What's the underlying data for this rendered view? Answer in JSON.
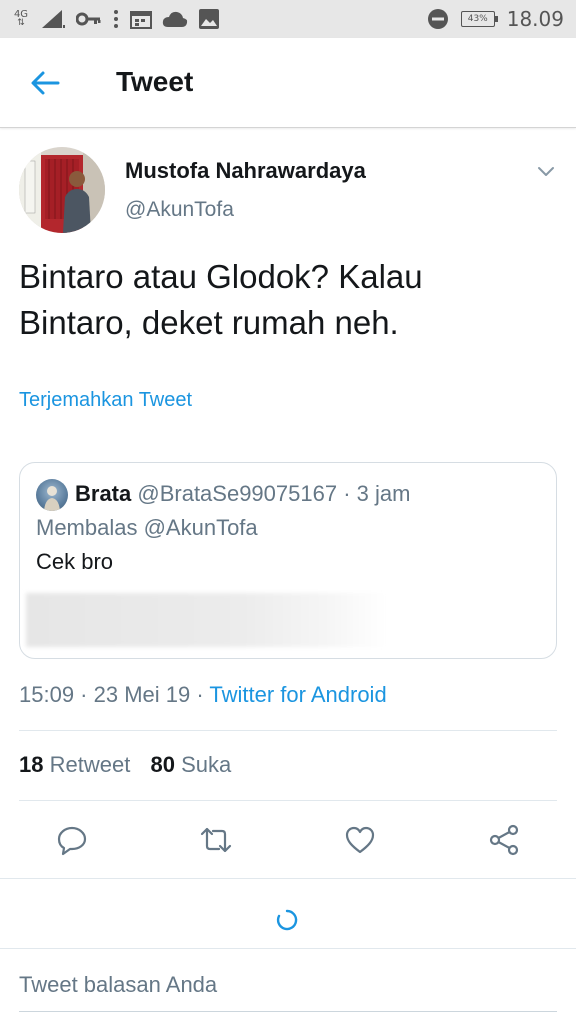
{
  "status_bar": {
    "network": "4G",
    "battery": "43%",
    "time": "18.09"
  },
  "header": {
    "title": "Tweet"
  },
  "tweet": {
    "author_name": "Mustofa Nahrawardaya",
    "author_handle": "@AkunTofa",
    "text_line1": "Bintaro atau Glodok? Kalau",
    "text_line2": "Bintaro, deket rumah neh.",
    "translate_label": "Terjemahkan Tweet",
    "time_date": "15:09 · 23 Mei 19 · ",
    "source": "Twitter for Android"
  },
  "quoted_tweet": {
    "name": "Brata",
    "meta": "@BrataSe99075167 · 3 jam",
    "replying_to": "Membalas @AkunTofa",
    "text": "Cek bro"
  },
  "stats": {
    "retweet_count": "18",
    "retweet_label": "Retweet",
    "like_count": "80",
    "like_label": "Suka"
  },
  "actions": [
    "reply-icon",
    "retweet-icon",
    "like-icon",
    "share-icon"
  ],
  "reply_box": {
    "placeholder": "Tweet balasan Anda"
  },
  "colors": {
    "accent": "#1b95e0",
    "secondary_text": "#657786",
    "primary_text": "#14171a"
  }
}
